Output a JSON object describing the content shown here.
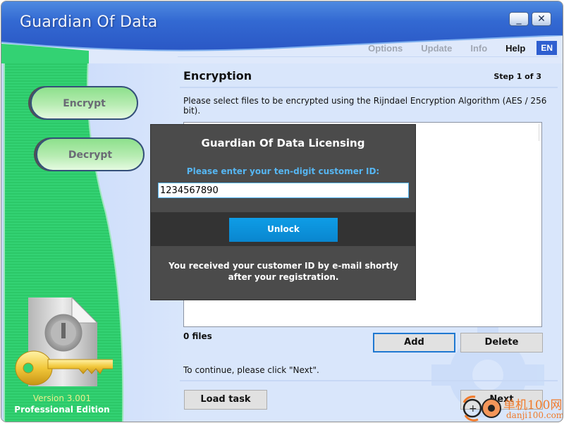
{
  "window": {
    "title": "Guardian Of Data",
    "minimize_label": "_",
    "close_label": "✕"
  },
  "topnav": {
    "items": [
      {
        "label": "Options",
        "active": false
      },
      {
        "label": "Update",
        "active": false
      },
      {
        "label": "Info",
        "active": false
      },
      {
        "label": "Help",
        "active": true
      }
    ],
    "language": "EN"
  },
  "sidebar": {
    "buttons": [
      {
        "label": "Encrypt"
      },
      {
        "label": "Decrypt"
      }
    ],
    "version": "Version 3.001",
    "edition": "Professional Edition",
    "logo_icon": "file-lock-key-icon"
  },
  "main": {
    "title": "Encryption",
    "step": "Step 1 of 3",
    "description": "Please select files to be encrypted using the Rijndael Encryption Algorithm (AES / 256 bit).",
    "files_count": "0 files",
    "add_label": "Add",
    "delete_label": "Delete",
    "continue_text": "To continue, please click \"Next\".",
    "load_task_label": "Load task",
    "next_label": "Next"
  },
  "dialog": {
    "title": "Guardian Of Data Licensing",
    "prompt": "Please enter your ten-digit customer ID:",
    "customer_id": "1234567890",
    "unlock_label": "Unlock",
    "note": "You received your customer ID by e-mail shortly after your registration."
  },
  "watermark": {
    "line1": "单机100网",
    "line2": "danji100.com"
  },
  "colors": {
    "titlebar": "#3369d2",
    "sidebar_green": "#2fcf6e",
    "content_bg": "#d9e6fb",
    "dialog_bg": "#4b4b4b",
    "accent_blue": "#0a86cf",
    "prompt_blue": "#56b6f2"
  }
}
